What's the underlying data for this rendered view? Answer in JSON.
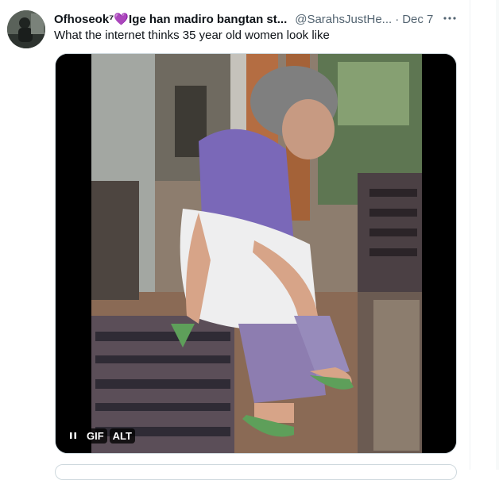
{
  "tweet": {
    "display_name": "Ofhoseok⁷💜Ige han madiro bangtan st...",
    "handle": "@SarahsJustHe...",
    "separator": "·",
    "date": "Dec 7",
    "text": "What the internet thinks 35 year old women look like",
    "more_icon": "more-horizontal-icon",
    "avatar_icon": "avatar-image"
  },
  "media": {
    "type": "gif",
    "pause_icon": "pause-icon",
    "gif_badge": "GIF",
    "alt_badge": "ALT"
  }
}
